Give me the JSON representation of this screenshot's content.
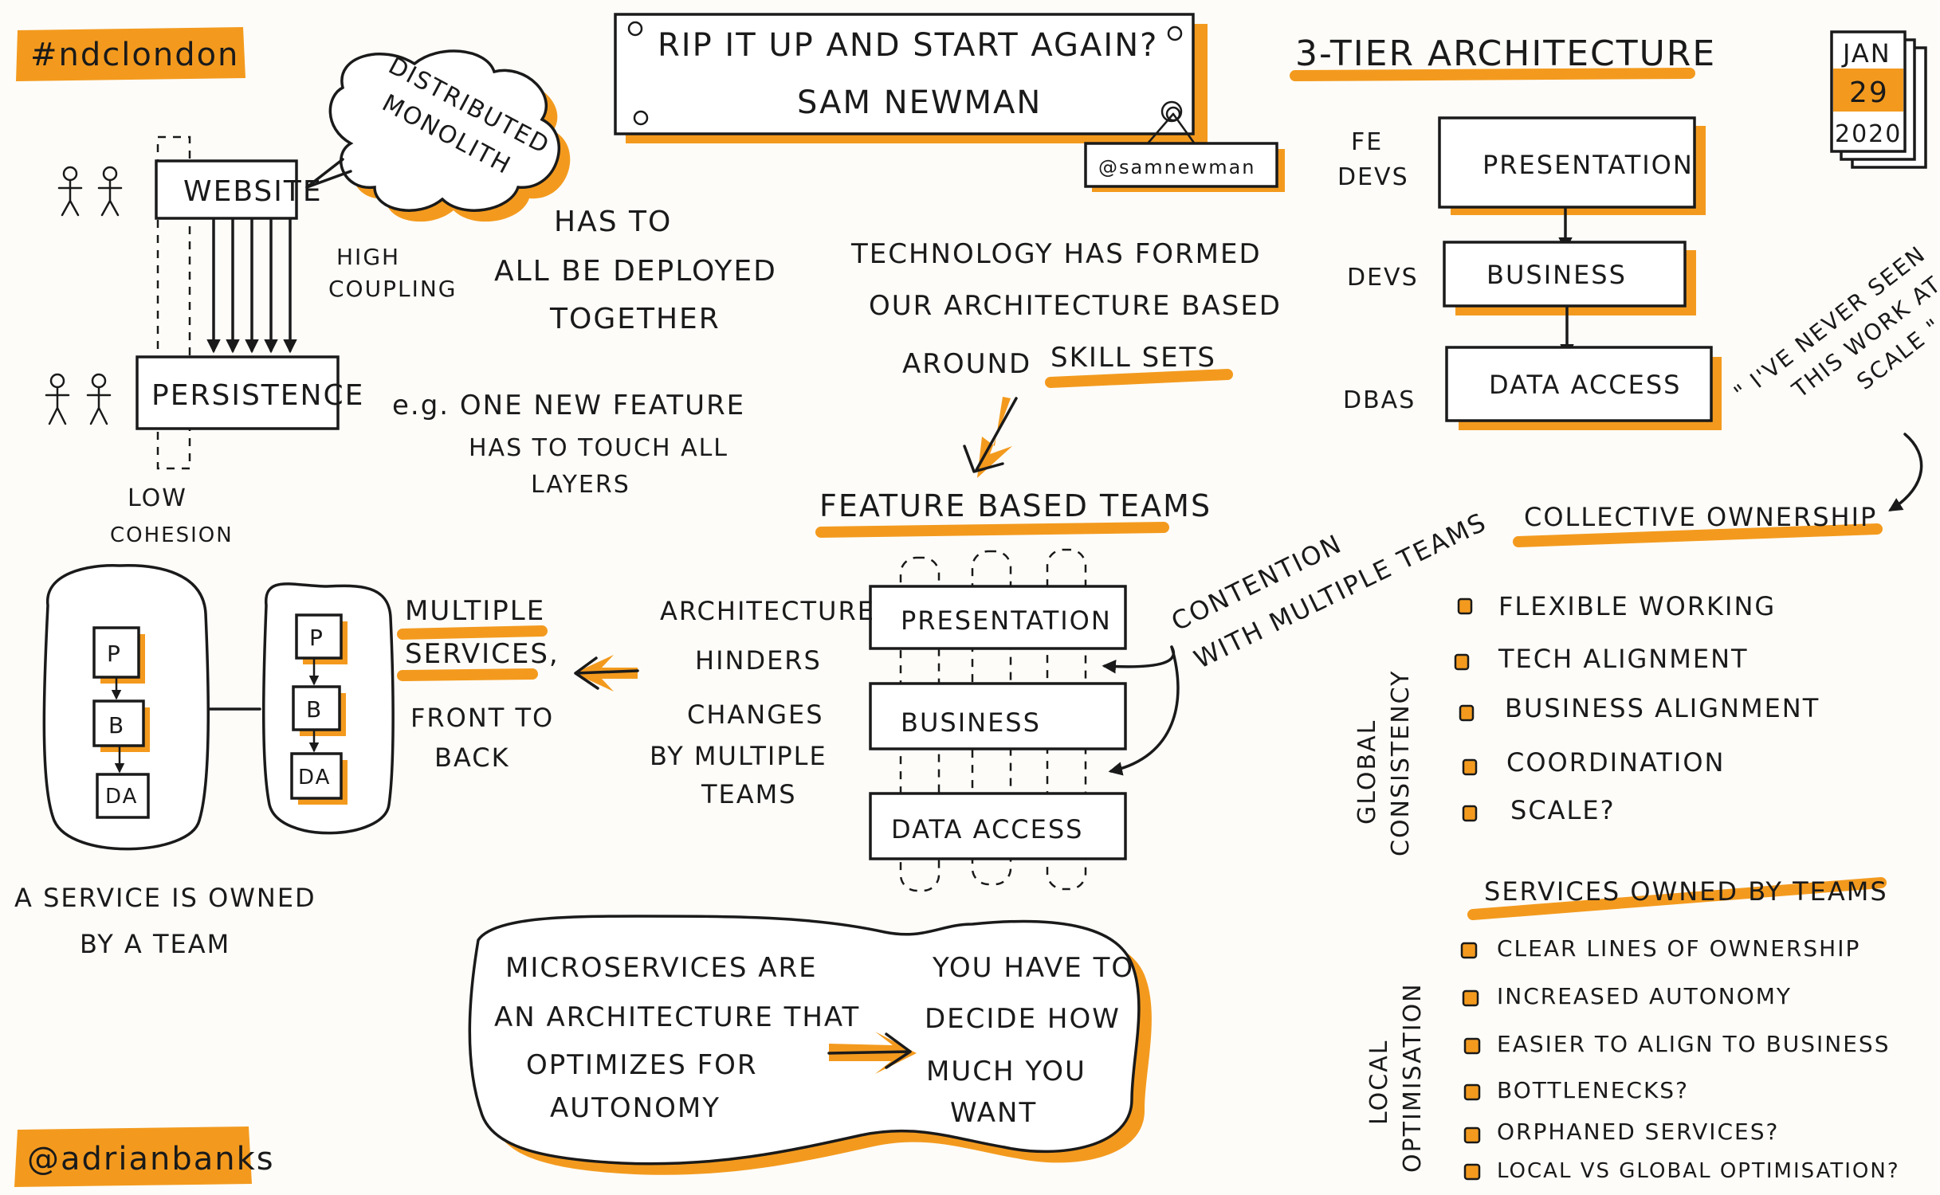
{
  "tags": {
    "hashtag": "#ndclondon",
    "author_handle": "@adrianbanks",
    "speaker_handle": "@samnewman"
  },
  "title": {
    "line1": "RIP IT UP AND START AGAIN?",
    "speaker": "SAM NEWMAN"
  },
  "date": {
    "month": "JAN",
    "day": "29",
    "year": "2020"
  },
  "monolith": {
    "cloud_line1": "DISTRIBUTED",
    "cloud_line2": "MONOLITH",
    "top_box": "WEBSITE",
    "bottom_box": "PERSISTENCE",
    "coupling_line1": "HIGH",
    "coupling_line2": "COUPLING",
    "cohesion_line1": "LOW",
    "cohesion_line2": "COHESION",
    "deploy_line1": "HAS TO",
    "deploy_line2": "ALL BE DEPLOYED",
    "deploy_line3": "TOGETHER",
    "example_line1": "e.g. ONE NEW FEATURE",
    "example_line2": "HAS TO TOUCH ALL",
    "example_line3": "LAYERS"
  },
  "technology": {
    "line1": "TECHNOLOGY  HAS FORMED",
    "line2": "OUR ARCHITECTURE BASED",
    "line3": "AROUND",
    "line3_highlight": "SKILL SETS"
  },
  "three_tier": {
    "title": "3-TIER ARCHITECTURE",
    "fe_line1": "FE",
    "fe_line2": "DEVS",
    "devs": "DEVS",
    "dbas": "DBAS",
    "layers": [
      "PRESENTATION",
      "BUSINESS",
      "DATA ACCESS"
    ]
  },
  "quote": {
    "line1": "\" I'VE NEVER SEEN",
    "line2": "THIS WORK AT",
    "line3": "SCALE \""
  },
  "feature_teams": {
    "title": "FEATURE BASED TEAMS",
    "layers": [
      "PRESENTATION",
      "BUSINESS",
      "DATA ACCESS"
    ],
    "contention_line1": "CONTENTION",
    "contention_line2": "WITH MULTIPLE TEAMS",
    "hinders_line1": "ARCHITECTURE",
    "hinders_line2": "HINDERS",
    "hinders_line3": "CHANGES",
    "hinders_line4": "BY MULTIPLE",
    "hinders_line5": "TEAMS"
  },
  "services": {
    "multiple_line1": "MULTIPLE",
    "multiple_line2": "SERVICES,",
    "front_line1": "FRONT TO",
    "front_line2": "BACK",
    "node_p": "P",
    "node_b": "B",
    "node_da": "DA",
    "owned_line1": "A SERVICE IS OWNED",
    "owned_line2": "BY A TEAM"
  },
  "collective": {
    "title": "COLLECTIVE  OWNERSHIP",
    "side_line1": "GLOBAL",
    "side_line2": "CONSISTENCY",
    "items": [
      "FLEXIBLE WORKING",
      "TECH ALIGNMENT",
      "BUSINESS ALIGNMENT",
      "COORDINATION",
      "SCALE?"
    ]
  },
  "owned_by_teams": {
    "title": "SERVICES OWNED BY TEAMS",
    "side_line1": "LOCAL",
    "side_line2": "OPTIMISATION",
    "items": [
      "CLEAR LINES OF OWNERSHIP",
      "INCREASED AUTONOMY",
      "EASIER TO ALIGN TO BUSINESS",
      "BOTTLENECKS?",
      "ORPHANED SERVICES?",
      "LOCAL VS GLOBAL OPTIMISATION?"
    ]
  },
  "microservices": {
    "left_line1": "MICROSERVICES ARE",
    "left_line2": "AN ARCHITECTURE THAT",
    "left_line3": "OPTIMIZES FOR",
    "left_line4": "AUTONOMY",
    "right_line1": "YOU HAVE TO",
    "right_line2": "DECIDE HOW",
    "right_line3": "MUCH YOU",
    "right_line4": "WANT"
  },
  "colors": {
    "accent": "#f39a1e",
    "ink": "#1a1a1a",
    "paper": "#fdfcf9"
  }
}
